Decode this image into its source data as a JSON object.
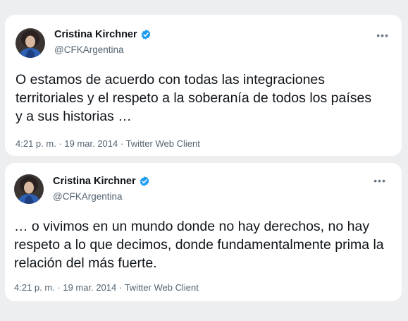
{
  "tweets": [
    {
      "author": {
        "display_name": "Cristina Kirchner",
        "handle": "@CFKArgentina",
        "verified": true
      },
      "text": "O estamos de acuerdo con todas las integraciones territoriales y el respeto a la soberanía de todos los países y a sus historias …",
      "timestamp": "4:21 p. m. · 19 mar. 2014 · Twitter Web Client",
      "more_icon": "more-horizontal-icon"
    },
    {
      "author": {
        "display_name": "Cristina Kirchner",
        "handle": "@CFKArgentina",
        "verified": true
      },
      "text": "… o vivimos en un mundo donde no hay derechos, no hay respeto a lo que decimos, donde fundamentalmente prima la relación del más fuerte.",
      "timestamp": "4:21 p. m. · 19 mar. 2014 · Twitter Web Client",
      "more_icon": "more-horizontal-icon"
    }
  ],
  "colors": {
    "background": "#edeef0",
    "card": "#ffffff",
    "verified_badge": "#1d9bf0",
    "secondary_text": "#536471"
  }
}
